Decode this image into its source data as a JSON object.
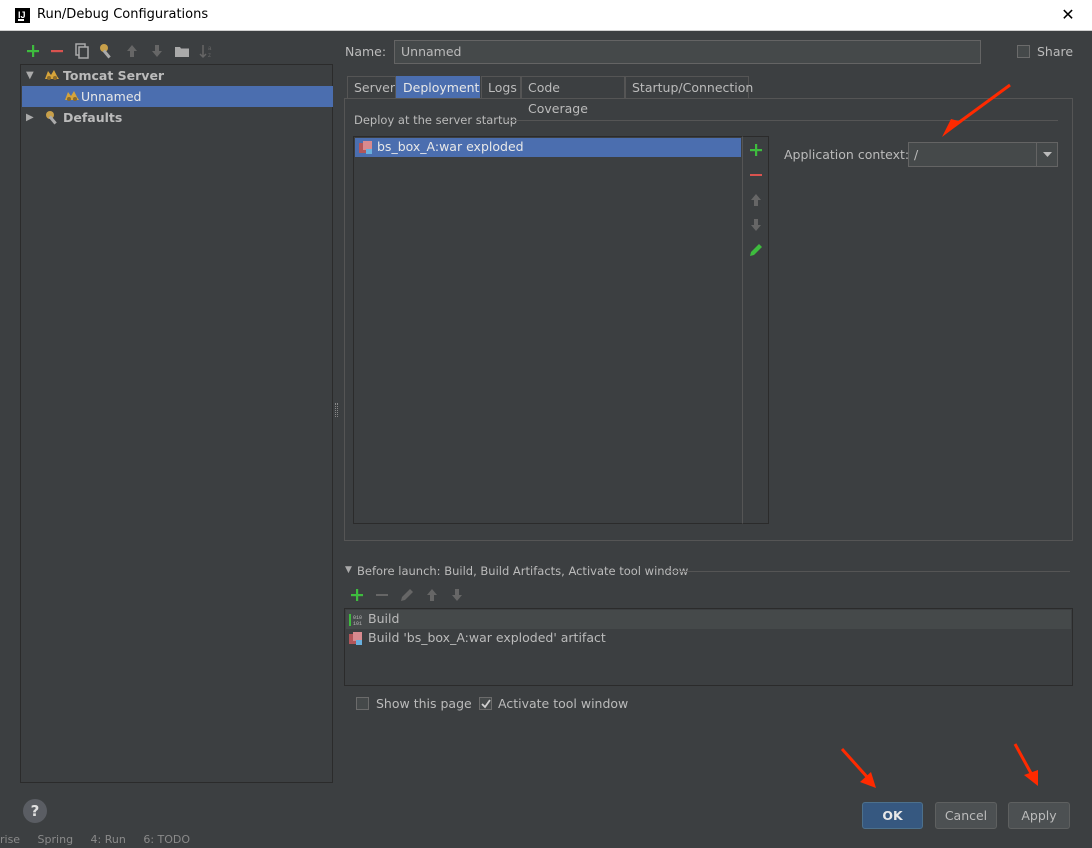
{
  "window": {
    "title": "Run/Debug Configurations",
    "close_glyph": "✕"
  },
  "toolbar": {
    "icons": [
      "add-icon",
      "remove-icon",
      "copy-icon",
      "edit-defaults-icon",
      "move-up-icon",
      "move-down-icon",
      "folder-icon",
      "sort-icon"
    ]
  },
  "tree": {
    "items": [
      {
        "label": "Tomcat Server",
        "expanded": true,
        "icon": "tomcat-icon"
      },
      {
        "label": "Unnamed",
        "selected": true,
        "icon": "tomcat-icon"
      },
      {
        "label": "Defaults",
        "expanded": false,
        "icon": "wrench-icon"
      }
    ]
  },
  "config": {
    "name_label": "Name:",
    "name_value": "Unnamed",
    "share_label": "Share",
    "share_checked": false
  },
  "tabs": [
    {
      "label": "Server",
      "active": false
    },
    {
      "label": "Deployment",
      "active": true
    },
    {
      "label": "Logs",
      "active": false
    },
    {
      "label": "Code Coverage",
      "active": false
    },
    {
      "label": "Startup/Connection",
      "active": false
    }
  ],
  "deployment": {
    "section_title": "Deploy at the server startup",
    "artifacts": [
      {
        "label": "bs_box_A:war exploded",
        "selected": true
      }
    ],
    "context_label": "Application context:",
    "context_value": "/"
  },
  "before_launch": {
    "title": "Before launch: Build, Build Artifacts, Activate tool window",
    "items": [
      {
        "label": "Build"
      },
      {
        "label": "Build 'bs_box_A:war exploded' artifact"
      }
    ]
  },
  "options": {
    "show_page_label": "Show this page",
    "show_page_checked": false,
    "activate_label": "Activate tool window",
    "activate_checked": true
  },
  "buttons": {
    "ok": "OK",
    "cancel": "Cancel",
    "apply": "Apply",
    "help": "?"
  },
  "statusbar": {
    "text": "rise     Spring     4: Run     6: TODO"
  },
  "colors": {
    "accent": "#4b6eaf",
    "arrow": "#ff2a00",
    "add": "#3ebc3e",
    "remove": "#d9534f"
  }
}
